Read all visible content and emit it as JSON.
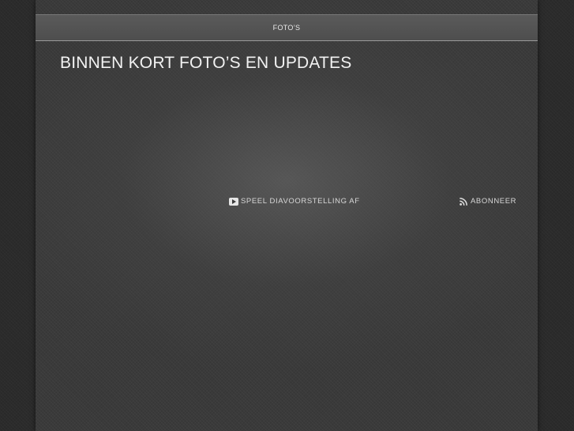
{
  "nav": {
    "items": [
      {
        "label": "FOTO’S"
      }
    ]
  },
  "page": {
    "title": "BINNEN KORT FOTO’S EN UPDATES"
  },
  "actions": {
    "slideshow_label": "SPEEL DIAVOORSTELLING AF",
    "slideshow_icon": "play-icon",
    "subscribe_label": "ABONNEER",
    "subscribe_icon": "rss-icon"
  },
  "colors": {
    "background": "#2b2b2b",
    "column": "#3a3a3a",
    "nav_bar": "#555555",
    "text": "#f2f2f2"
  }
}
